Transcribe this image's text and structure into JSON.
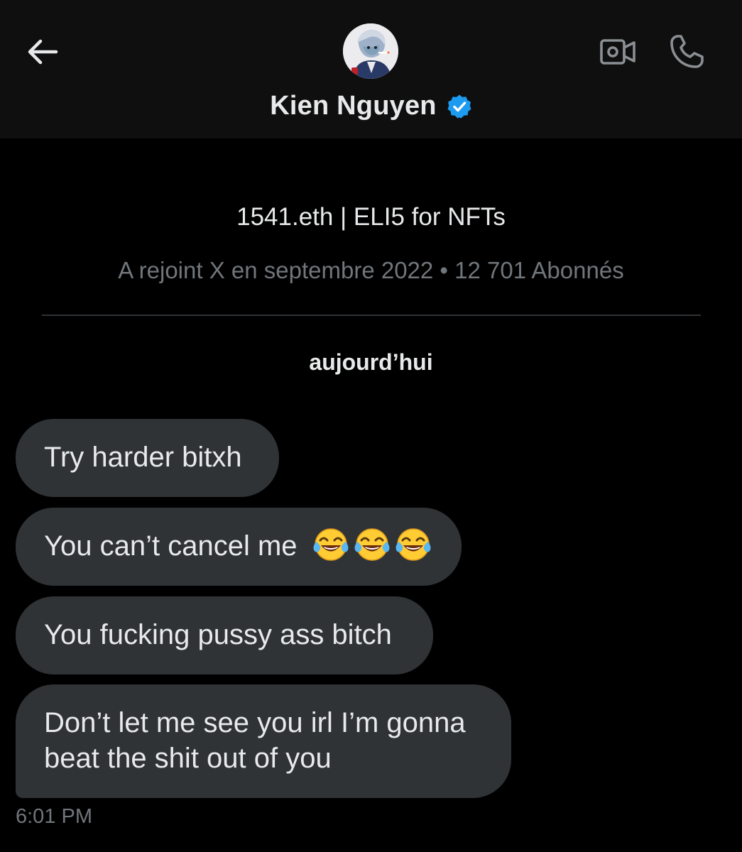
{
  "header": {
    "name": "Kien Nguyen",
    "verified": true,
    "accent_color": "#1d9bf0",
    "icons": {
      "back": "back-arrow-icon",
      "video": "video-camera-icon",
      "phone": "phone-icon"
    }
  },
  "profile": {
    "bio": "1541.eth | ELI5 for NFTs",
    "meta": "A rejoint X en septembre 2022 • 12 701 Abonnés"
  },
  "date_label": "aujourd’hui",
  "messages": [
    {
      "text": "Try harder bitxh"
    },
    {
      "text": "You can’t cancel me",
      "emoji": "face-with-tears-of-joy",
      "emoji_count": 3
    },
    {
      "text": "You fucking pussy ass bitch"
    },
    {
      "text": "Don’t let me see you irl I’m gonna beat the shit out of you"
    }
  ],
  "timestamp": "6:01 PM",
  "colors": {
    "background": "#000000",
    "header_bg": "#0f0f0f",
    "bubble_bg": "#2f3336",
    "text_primary": "#e7e9ea",
    "text_secondary": "#71767b"
  }
}
